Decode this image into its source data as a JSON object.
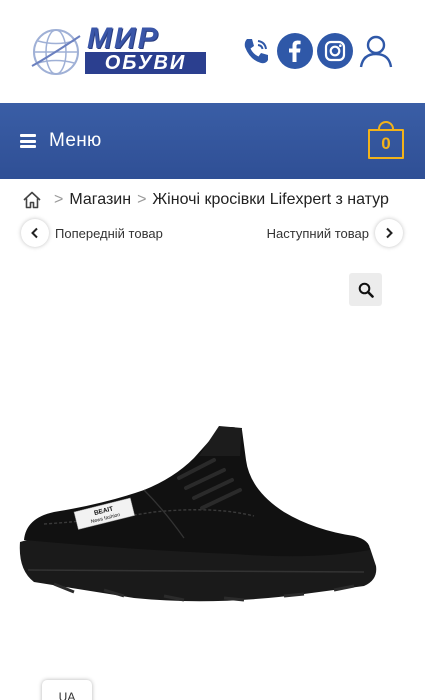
{
  "header": {
    "logo": {
      "line1": "МИР",
      "line2": "ОБУВИ"
    },
    "icons": [
      "phone-icon",
      "facebook-icon",
      "instagram-icon",
      "user-icon"
    ]
  },
  "menubar": {
    "menu_label": "Меню",
    "cart_count": "0",
    "colors": {
      "bar": "#3a5ea6",
      "cart": "#f2b21a"
    }
  },
  "breadcrumb": {
    "shop": "Магазин",
    "current": "Жіночі кросівки Lifexpert з натур",
    "separator": ">"
  },
  "product_nav": {
    "prev_label": "Попередній товар",
    "next_label": "Наступний товар"
  },
  "shoe_label": {
    "line1": "BEAIT",
    "line2": "News fashion"
  },
  "language": "UA"
}
